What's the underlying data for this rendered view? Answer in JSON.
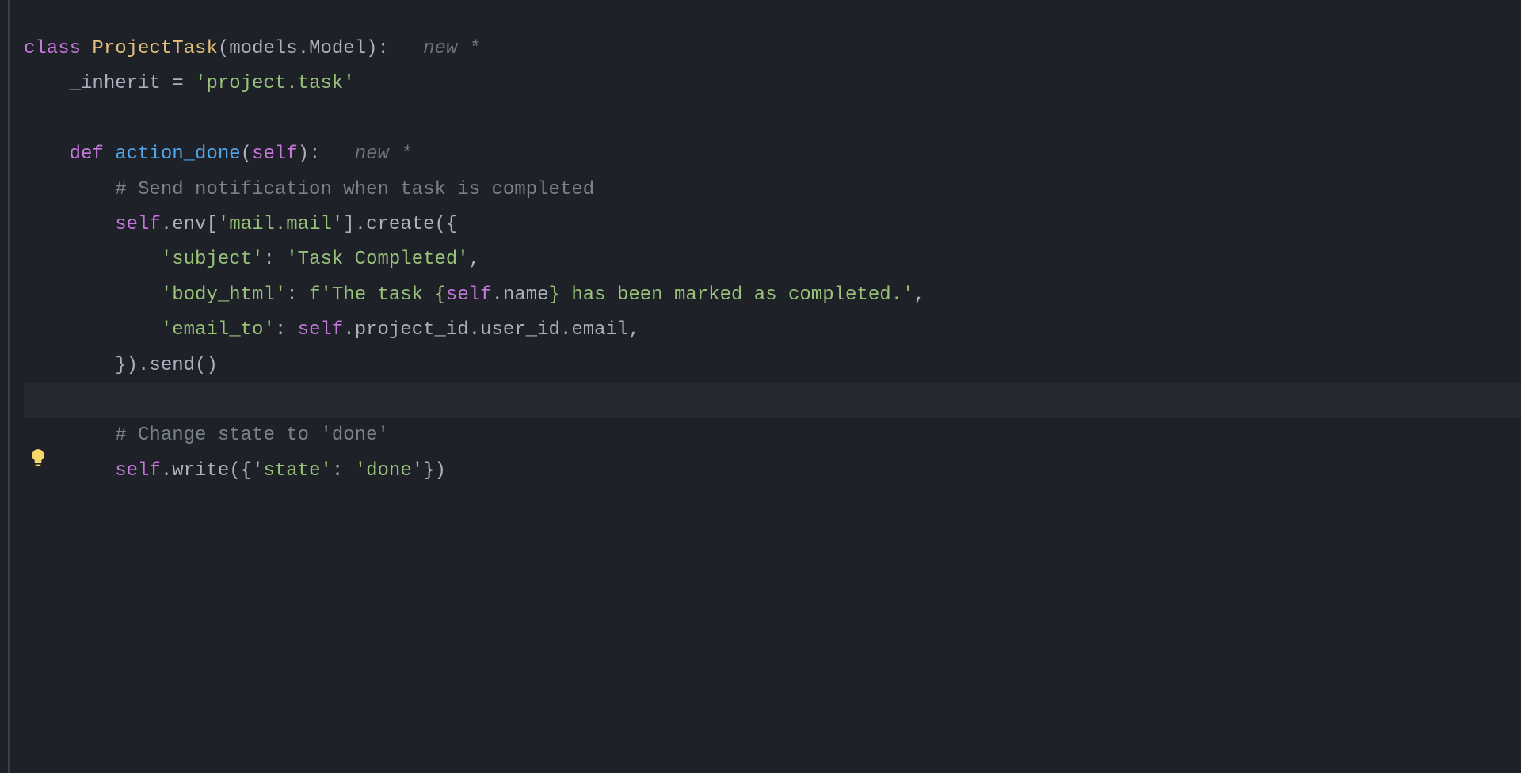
{
  "hints": {
    "class_hint": "new *",
    "method_hint": "new *"
  },
  "code": {
    "l1": {
      "kw_class": "class ",
      "cls_name": "ProjectTask",
      "paren_open": "(",
      "module": "models",
      "dot": ".",
      "model": "Model",
      "paren_close": ")",
      "colon": ":"
    },
    "l2": {
      "indent": "    ",
      "attr": "_inherit",
      "assign": " = ",
      "value": "'project.task'"
    },
    "l3": {
      "indent": "    ",
      "kw_def": "def ",
      "fn_name": "action_done",
      "paren_open": "(",
      "self": "self",
      "paren_close": ")",
      "colon": ":"
    },
    "l4": {
      "indent": "        ",
      "comment": "# Send notification when task is completed"
    },
    "l5": {
      "indent": "        ",
      "self": "self",
      "dot1": ".",
      "env": "env",
      "bopen": "[",
      "key": "'mail.mail'",
      "bclose": "]",
      "dot2": ".",
      "create": "create",
      "paren": "({"
    },
    "l6": {
      "indent": "            ",
      "key": "'subject'",
      "colon": ": ",
      "val": "'Task Completed'",
      "comma": ","
    },
    "l7": {
      "indent": "            ",
      "key": "'body_html'",
      "colon": ": ",
      "fprefix": "f",
      "str1": "'The task {",
      "self": "self",
      "dot": ".",
      "name": "name",
      "str2": "} has been marked as completed.'",
      "comma": ","
    },
    "l8": {
      "indent": "            ",
      "key": "'email_to'",
      "colon": ": ",
      "self": "self",
      "dot1": ".",
      "proj": "project_id",
      "dot2": ".",
      "user": "user_id",
      "dot3": ".",
      "email": "email",
      "comma": ","
    },
    "l9": {
      "indent": "        ",
      "close": "})",
      "dot": ".",
      "send": "send",
      "paren": "()"
    },
    "l10": {
      "indent": "        ",
      "comment": "# Change state to 'done'"
    },
    "l11": {
      "indent": "        ",
      "self": "self",
      "dot": ".",
      "write": "write",
      "popen": "({",
      "key": "'state'",
      "colon": ": ",
      "val": "'done'",
      "pclose": "})"
    }
  }
}
